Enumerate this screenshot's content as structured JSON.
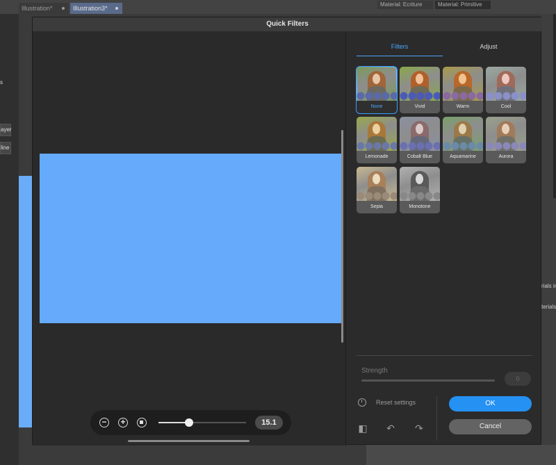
{
  "app": {
    "tabs": [
      {
        "label": "Illustration*",
        "active": false
      },
      {
        "label": "Illustration3*",
        "active": true
      }
    ],
    "materials_tabs": [
      "Material: Ecriture",
      "Material: Primitive"
    ],
    "left_labels": [
      "s",
      "ayer",
      "line"
    ],
    "right_labels": [
      "rials in",
      "terials"
    ]
  },
  "dialog": {
    "title": "Quick Filters",
    "canvas_color": "#66abfb",
    "zoom": {
      "value": "15.1",
      "slider_fraction": 0.35,
      "zoom_out_icon": "zoom-out-icon",
      "zoom_in_icon": "zoom-in-icon",
      "fit_icon": "fit-screen-icon"
    },
    "tabs": [
      {
        "label": "Filters",
        "active": true
      },
      {
        "label": "Adjust",
        "active": false
      }
    ],
    "filters": [
      {
        "label": "None",
        "selected": true,
        "tint": "#7a9a5a",
        "hair": "#a0653a",
        "skin": "#e8c6a8",
        "body": "#6c6a60",
        "flowers": "#5a6aa8"
      },
      {
        "label": "Vivid",
        "selected": false,
        "tint": "#8aa84a",
        "hair": "#b0602a",
        "skin": "#f0c098",
        "body": "#6e6a58",
        "flowers": "#4a5ab8"
      },
      {
        "label": "Warm",
        "selected": false,
        "tint": "#a89a4a",
        "hair": "#b8682a",
        "skin": "#f0c290",
        "body": "#7a6a4a",
        "flowers": "#8a6aa0"
      },
      {
        "label": "Cool",
        "selected": false,
        "tint": "#9aa8a0",
        "hair": "#a06a5a",
        "skin": "#ecc8c0",
        "body": "#70707a",
        "flowers": "#8a90c8"
      },
      {
        "label": "Lemonade",
        "selected": false,
        "tint": "#9aa84a",
        "hair": "#a8783a",
        "skin": "#ecd0a0",
        "body": "#6c6c50",
        "flowers": "#6a78a8"
      },
      {
        "label": "Cobalt Blue",
        "selected": false,
        "tint": "#8a90a0",
        "hair": "#8a6a6a",
        "skin": "#d8c8c8",
        "body": "#646878",
        "flowers": "#6a70b0"
      },
      {
        "label": "Aquamarine",
        "selected": false,
        "tint": "#7aa06a",
        "hair": "#9a7a4a",
        "skin": "#e0d0b0",
        "body": "#667066",
        "flowers": "#6a8aa8"
      },
      {
        "label": "Aurora",
        "selected": false,
        "tint": "#9aa08a",
        "hair": "#a07a5a",
        "skin": "#e8d0b8",
        "body": "#707068",
        "flowers": "#8a88b8"
      },
      {
        "label": "Sepia",
        "selected": false,
        "tint": "#c8b890",
        "hair": "#a8805a",
        "skin": "#ecdcc0",
        "body": "#807060",
        "flowers": "#9a8a78"
      },
      {
        "label": "Monotone",
        "selected": false,
        "tint": "#b0b0b0",
        "hair": "#5a5a5a",
        "skin": "#d8d8d8",
        "body": "#6a6a6a",
        "flowers": "#888888"
      }
    ],
    "strength": {
      "label": "Strength",
      "value": "0"
    },
    "reset_label": "Reset settings",
    "ok_label": "OK",
    "cancel_label": "Cancel",
    "colors": {
      "accent": "#2491f3",
      "tab_active": "#4aa6ff"
    }
  }
}
